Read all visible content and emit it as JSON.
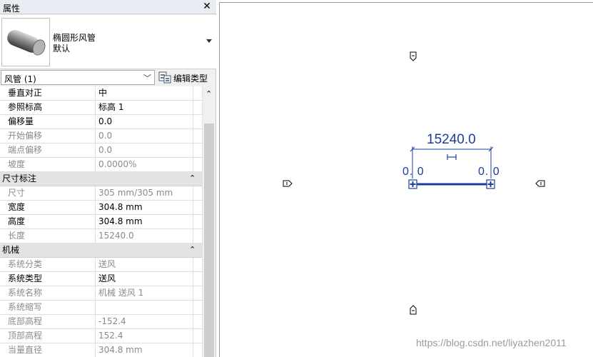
{
  "panel": {
    "title": "属性",
    "close_glyph": "✕",
    "type_selector": {
      "name": "椭圆形风管",
      "subtype": "默认"
    },
    "filter": {
      "value": "风管 (1)",
      "edit_type_label": "编辑类型"
    },
    "rows": [
      {
        "kind": "prop",
        "key": "垂直对正",
        "value": "中",
        "grey": false
      },
      {
        "kind": "prop",
        "key": "参照标高",
        "value": "标高 1",
        "grey": false
      },
      {
        "kind": "prop",
        "key": "偏移量",
        "value": "0.0",
        "grey": false
      },
      {
        "kind": "prop",
        "key": "开始偏移",
        "value": "0.0",
        "grey": true
      },
      {
        "kind": "prop",
        "key": "端点偏移",
        "value": "0.0",
        "grey": true
      },
      {
        "kind": "prop",
        "key": "坡度",
        "value": "0.0000%",
        "grey": true
      },
      {
        "kind": "group",
        "key": "尺寸标注",
        "collapse_glyph": "⌃"
      },
      {
        "kind": "prop",
        "key": "尺寸",
        "value": "305 mm/305 mm",
        "grey": true
      },
      {
        "kind": "prop",
        "key": "宽度",
        "value": "304.8 mm",
        "grey": false
      },
      {
        "kind": "prop",
        "key": "高度",
        "value": "304.8 mm",
        "grey": false
      },
      {
        "kind": "prop",
        "key": "长度",
        "value": "15240.0",
        "grey": true
      },
      {
        "kind": "group",
        "key": "机械",
        "collapse_glyph": "⌃"
      },
      {
        "kind": "prop",
        "key": "系统分类",
        "value": "送风",
        "grey": true
      },
      {
        "kind": "prop",
        "key": "系统类型",
        "value": "送风",
        "grey": false
      },
      {
        "kind": "prop",
        "key": "系统名称",
        "value": "机械 送风 1",
        "grey": true
      },
      {
        "kind": "prop",
        "key": "系统缩写",
        "value": "",
        "grey": true
      },
      {
        "kind": "prop",
        "key": "底部高程",
        "value": "-152.4",
        "grey": true
      },
      {
        "kind": "prop",
        "key": "顶部高程",
        "value": "152.4",
        "grey": true
      },
      {
        "kind": "prop",
        "key": "当量直径",
        "value": "304.8 mm",
        "grey": true
      }
    ]
  },
  "canvas": {
    "dimension_main": "15240.0",
    "offset_left": "0. 0",
    "offset_right": "0. 0",
    "watermark": "https://blog.csdn.net/liyazhen2011"
  },
  "colors": {
    "annotation_blue": "#1a3c9e",
    "duct_blue": "#1d3f9c"
  }
}
